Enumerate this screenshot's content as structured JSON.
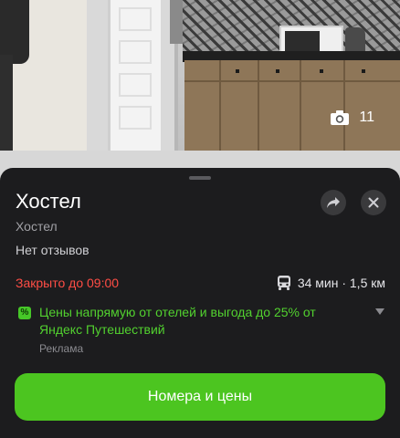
{
  "photo": {
    "count": "11",
    "camera_icon": "camera-icon"
  },
  "card": {
    "title": "Хостел",
    "category": "Хостел",
    "reviews": "Нет отзывов",
    "status": "Закрыто до 09:00",
    "transit": {
      "icon": "bus-icon",
      "text": "34 мин · 1,5 км"
    },
    "ad": {
      "badge": "%",
      "text": "Цены напрямую от отелей и выгода до 25% от Яндекс Путешествий",
      "label": "Реклама"
    },
    "cta_label": "Номера и цены"
  },
  "colors": {
    "sheet_bg": "#1c1c1e",
    "status_red": "#ff4d45",
    "ad_green": "#52d12f",
    "cta_green": "#4cc520"
  }
}
